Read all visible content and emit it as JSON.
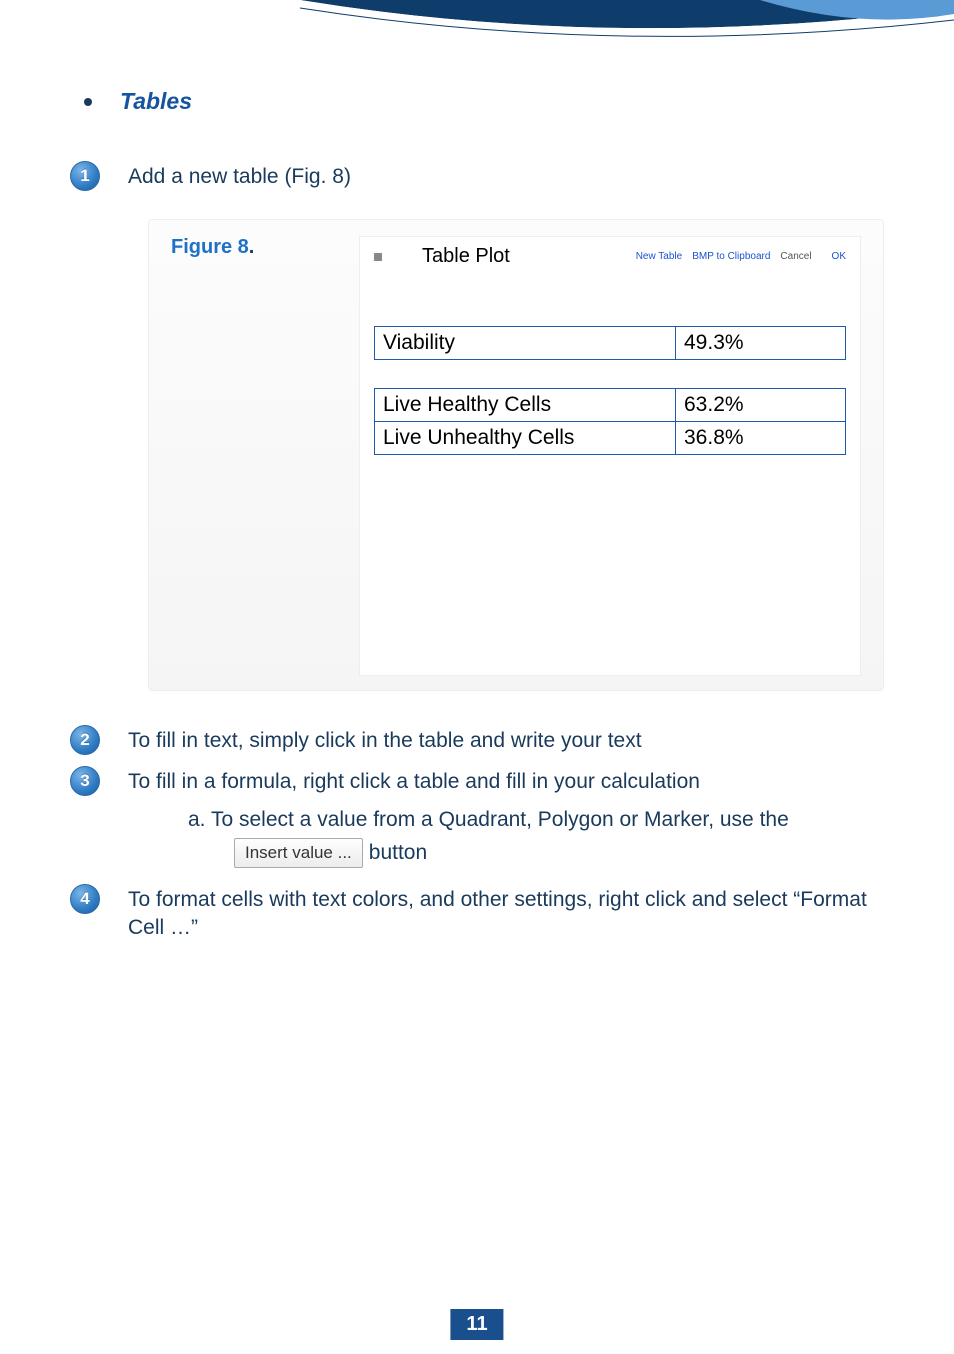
{
  "section": {
    "title": "Tables"
  },
  "steps": {
    "s1": {
      "num": "1",
      "text": "Add a new table (Fig. 8)"
    },
    "s2": {
      "num": "2",
      "text": "To fill in text, simply click in the table and write your text"
    },
    "s3": {
      "num": "3",
      "text": "To fill in a formula, right click a table and fill in your calculation"
    },
    "s3a": {
      "text": "a. To select a value from a Quadrant, Polygon or Marker, use the"
    },
    "s3a_btn": {
      "label": "Insert value ...",
      "after": "button"
    },
    "s4": {
      "num": "4",
      "text": "To format cells with text colors, and other settings, right click and select “Format Cell …”"
    }
  },
  "figure": {
    "label_prefix": "Figure 8",
    "window": {
      "title": "Table Plot",
      "toolbar": {
        "new_table": "New Table",
        "bmp": "BMP to Clipboard",
        "cancel": "Cancel",
        "ok": "OK"
      },
      "rows": {
        "r0": {
          "label": "Viability",
          "value": "49.3%"
        },
        "r1": {
          "label": "Live Healthy Cells",
          "value": "63.2%"
        },
        "r2": {
          "label": "Live Unhealthy Cells",
          "value": "36.8%"
        }
      }
    }
  },
  "page_number": "11"
}
